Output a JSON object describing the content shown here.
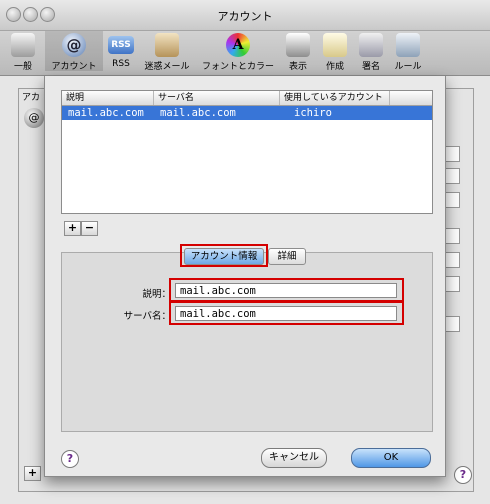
{
  "window": {
    "title": "アカウント"
  },
  "toolbar": {
    "items": [
      {
        "label": "一般",
        "icon": "switch-icon"
      },
      {
        "label": "アカウント",
        "icon": "at-sign-icon"
      },
      {
        "label": "RSS",
        "icon": "rss-icon"
      },
      {
        "label": "迷惑メール",
        "icon": "junk-mail-icon"
      },
      {
        "label": "フォントとカラー",
        "icon": "font-color-icon"
      },
      {
        "label": "表示",
        "icon": "display-icon"
      },
      {
        "label": "作成",
        "icon": "compose-icon"
      },
      {
        "label": "署名",
        "icon": "signature-icon"
      },
      {
        "label": "ルール",
        "icon": "rules-icon"
      }
    ]
  },
  "background": {
    "accounts_header": "アカ",
    "account_icon_glyph": "@"
  },
  "sheet": {
    "table": {
      "headers": [
        "説明",
        "サーバ名",
        "使用しているアカウント"
      ],
      "rows": [
        [
          "mail.abc.com",
          "mail.abc.com",
          "ichiro"
        ]
      ]
    },
    "add_label": "+",
    "remove_label": "−",
    "tabs": {
      "account_info": "アカウント情報",
      "details": "詳細"
    },
    "fields": {
      "description_label": "説明：",
      "description_value": "mail.abc.com",
      "server_label": "サーバ名：",
      "server_value": "mail.abc.com"
    },
    "help_label": "?",
    "cancel_label": "キャンセル",
    "ok_label": "OK"
  },
  "colors": {
    "selection": "#3875d7",
    "highlight_box": "#d40000",
    "default_button": "#4f97e6"
  }
}
